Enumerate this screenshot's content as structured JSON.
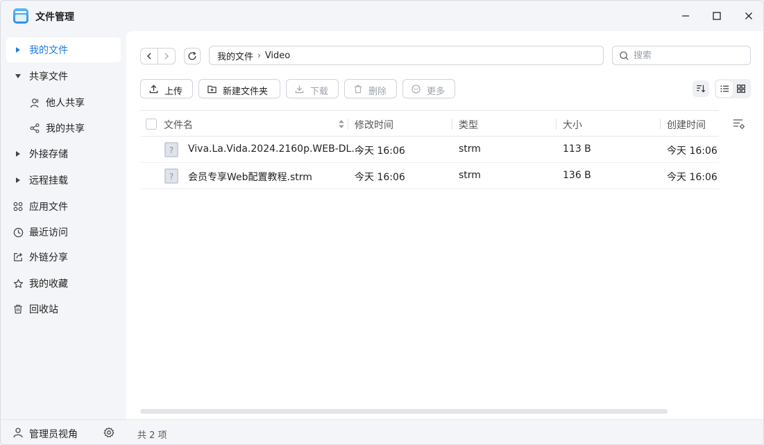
{
  "window": {
    "title": "文件管理",
    "controls": [
      "minimize-icon",
      "maximize-icon",
      "close-icon"
    ]
  },
  "sidebar": {
    "items": [
      {
        "label": "我的文件",
        "icon": "caret-right",
        "active": true
      },
      {
        "label": "共享文件",
        "icon": "caret-down",
        "active": false
      },
      {
        "label": "他人共享",
        "icon": "user-icon",
        "sub": true
      },
      {
        "label": "我的共享",
        "icon": "share-icon",
        "sub": true
      },
      {
        "label": "外接存储",
        "icon": "caret-right"
      },
      {
        "label": "远程挂载",
        "icon": "caret-right"
      },
      {
        "label": "应用文件",
        "icon": "apps-icon"
      },
      {
        "label": "最近访问",
        "icon": "clock-icon"
      },
      {
        "label": "外链分享",
        "icon": "external-link-icon"
      },
      {
        "label": "我的收藏",
        "icon": "star-icon"
      },
      {
        "label": "回收站",
        "icon": "trash-icon"
      }
    ],
    "footer": {
      "label": "管理员视角",
      "icon": "user-icon",
      "settings_icon": "gear-icon"
    }
  },
  "toolbar": {
    "path": [
      "我的文件",
      "Video"
    ],
    "search_placeholder": "搜索",
    "buttons": {
      "upload": "上传",
      "new_folder": "新建文件夹",
      "download": "下载",
      "delete": "删除",
      "more": "更多"
    }
  },
  "table": {
    "headers": {
      "name": "文件名",
      "modified": "修改时间",
      "type": "类型",
      "size": "大小",
      "created": "创建时间"
    },
    "rows": [
      {
        "name": "Viva.La.Vida.2024.2160p.WEB-DL....",
        "modified": "今天 16:06",
        "type": "strm",
        "size": "113 B",
        "created": "今天 16:06"
      },
      {
        "name": "会员专享Web配置教程.strm",
        "modified": "今天 16:06",
        "type": "strm",
        "size": "136 B",
        "created": "今天 16:06"
      }
    ]
  },
  "status": {
    "count_text": "共 2 项"
  },
  "colors": {
    "accent": "#1c7ce6",
    "sidebar_bg": "#f4f5f8",
    "main_bg": "#ffffff"
  }
}
